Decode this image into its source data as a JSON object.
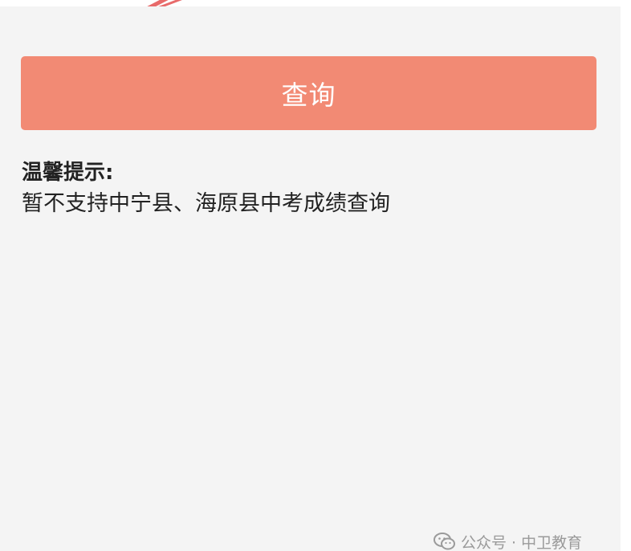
{
  "app": {
    "accent_color": "#f28a74",
    "background_color": "#f4f4f4"
  },
  "main": {
    "query_button_label": "查询",
    "tip_title": "温馨提示:",
    "tip_text": "暂不支持中宁县、海原县中考成绩查询"
  },
  "watermark": {
    "icon": "wechat-icon",
    "text": "公众号 · 中卫教育"
  }
}
